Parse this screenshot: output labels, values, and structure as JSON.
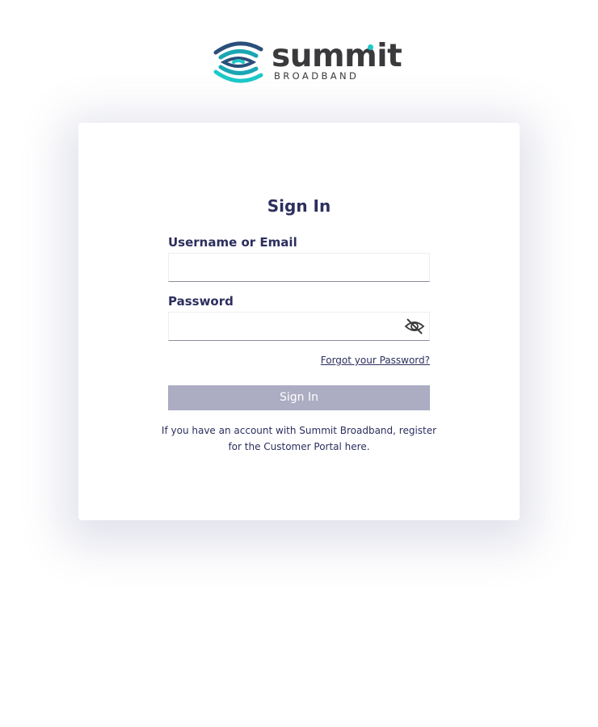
{
  "brand": {
    "name": "summit",
    "subtitle": "BROADBAND",
    "logo_icon": "summit-wave-logo",
    "colors": {
      "navy": "#2c2f5e",
      "teal": "#1ec8c8",
      "wordmark": "#3a3a3c",
      "button_disabled": "#acacc2"
    }
  },
  "form": {
    "title": "Sign In",
    "username": {
      "label": "Username or Email",
      "value": "",
      "placeholder": ""
    },
    "password": {
      "label": "Password",
      "value": "",
      "placeholder": "",
      "toggle_icon": "eye-slash-icon"
    },
    "forgot_link": "Forgot your Password?",
    "submit_label": "Sign In",
    "register_text": "If you have an account with Summit Broadband, register for the Customer Portal here."
  }
}
